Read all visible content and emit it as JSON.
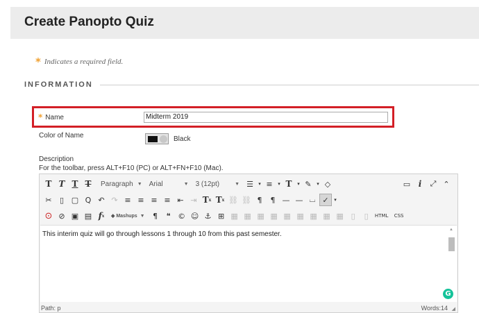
{
  "page": {
    "title": "Create Panopto Quiz"
  },
  "required_note": {
    "asterisk": "*",
    "text": "Indicates a required field."
  },
  "section": {
    "title": "INFORMATION"
  },
  "name_field": {
    "asterisk": "*",
    "label": "Name",
    "value": "Midterm 2019"
  },
  "color_field": {
    "label": "Color of Name",
    "swatch_color": "#111111",
    "value": "Black"
  },
  "description": {
    "label": "Description",
    "help": "For the toolbar, press ALT+F10 (PC) or ALT+FN+F10 (Mac).",
    "toolbar": {
      "paragraph": "Paragraph",
      "font": "Arial",
      "size": "3 (12pt)",
      "mashups": "Mashups"
    },
    "content": "This interim quiz will go through lessons 1 through 10 from this past semester.",
    "path": "Path: p",
    "words": "Words:14"
  },
  "colors": {
    "required_asterisk": "#f0a030",
    "highlight_border": "#d31f26",
    "grammarly": "#15c39a"
  }
}
